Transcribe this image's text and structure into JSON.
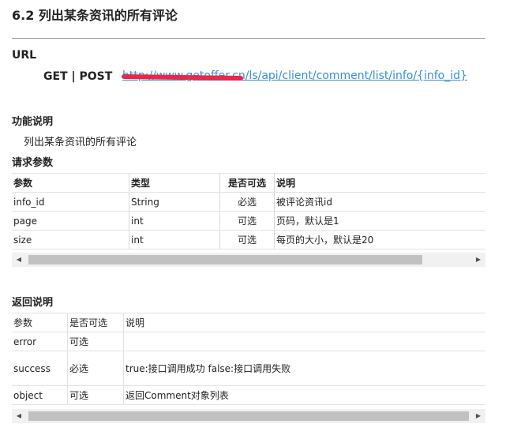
{
  "section_title": "6.2 列出某条资讯的所有评论",
  "url_section": {
    "heading": "URL",
    "method": "GET | POST",
    "link": "http://www.getoffer.cn/ls/api/client/comment/list/info/{info_id}"
  },
  "function": {
    "heading": "功能说明",
    "text": "列出某条资讯的所有评论"
  },
  "request_params": {
    "heading": "请求参数",
    "headers": [
      "参数",
      "类型",
      "是否可选",
      "说明"
    ],
    "rows": [
      [
        "info_id",
        "String",
        "必选",
        "被评论资讯id"
      ],
      [
        "page",
        "int",
        "可选",
        "页码，默认是1"
      ],
      [
        "size",
        "int",
        "可选",
        "每页的大小，默认是20"
      ]
    ]
  },
  "response": {
    "heading": "返回说明",
    "headers": [
      "参数",
      "是否可选",
      "说明"
    ],
    "rows": [
      [
        "error",
        "可选",
        ""
      ],
      [
        "success",
        "必选",
        "true:接口调用成功 false:接口调用失败"
      ],
      [
        "object",
        "可选",
        "返回Comment对象列表"
      ]
    ]
  },
  "scrollbar": {
    "left_arrow": "◀",
    "right_arrow": "▶"
  }
}
